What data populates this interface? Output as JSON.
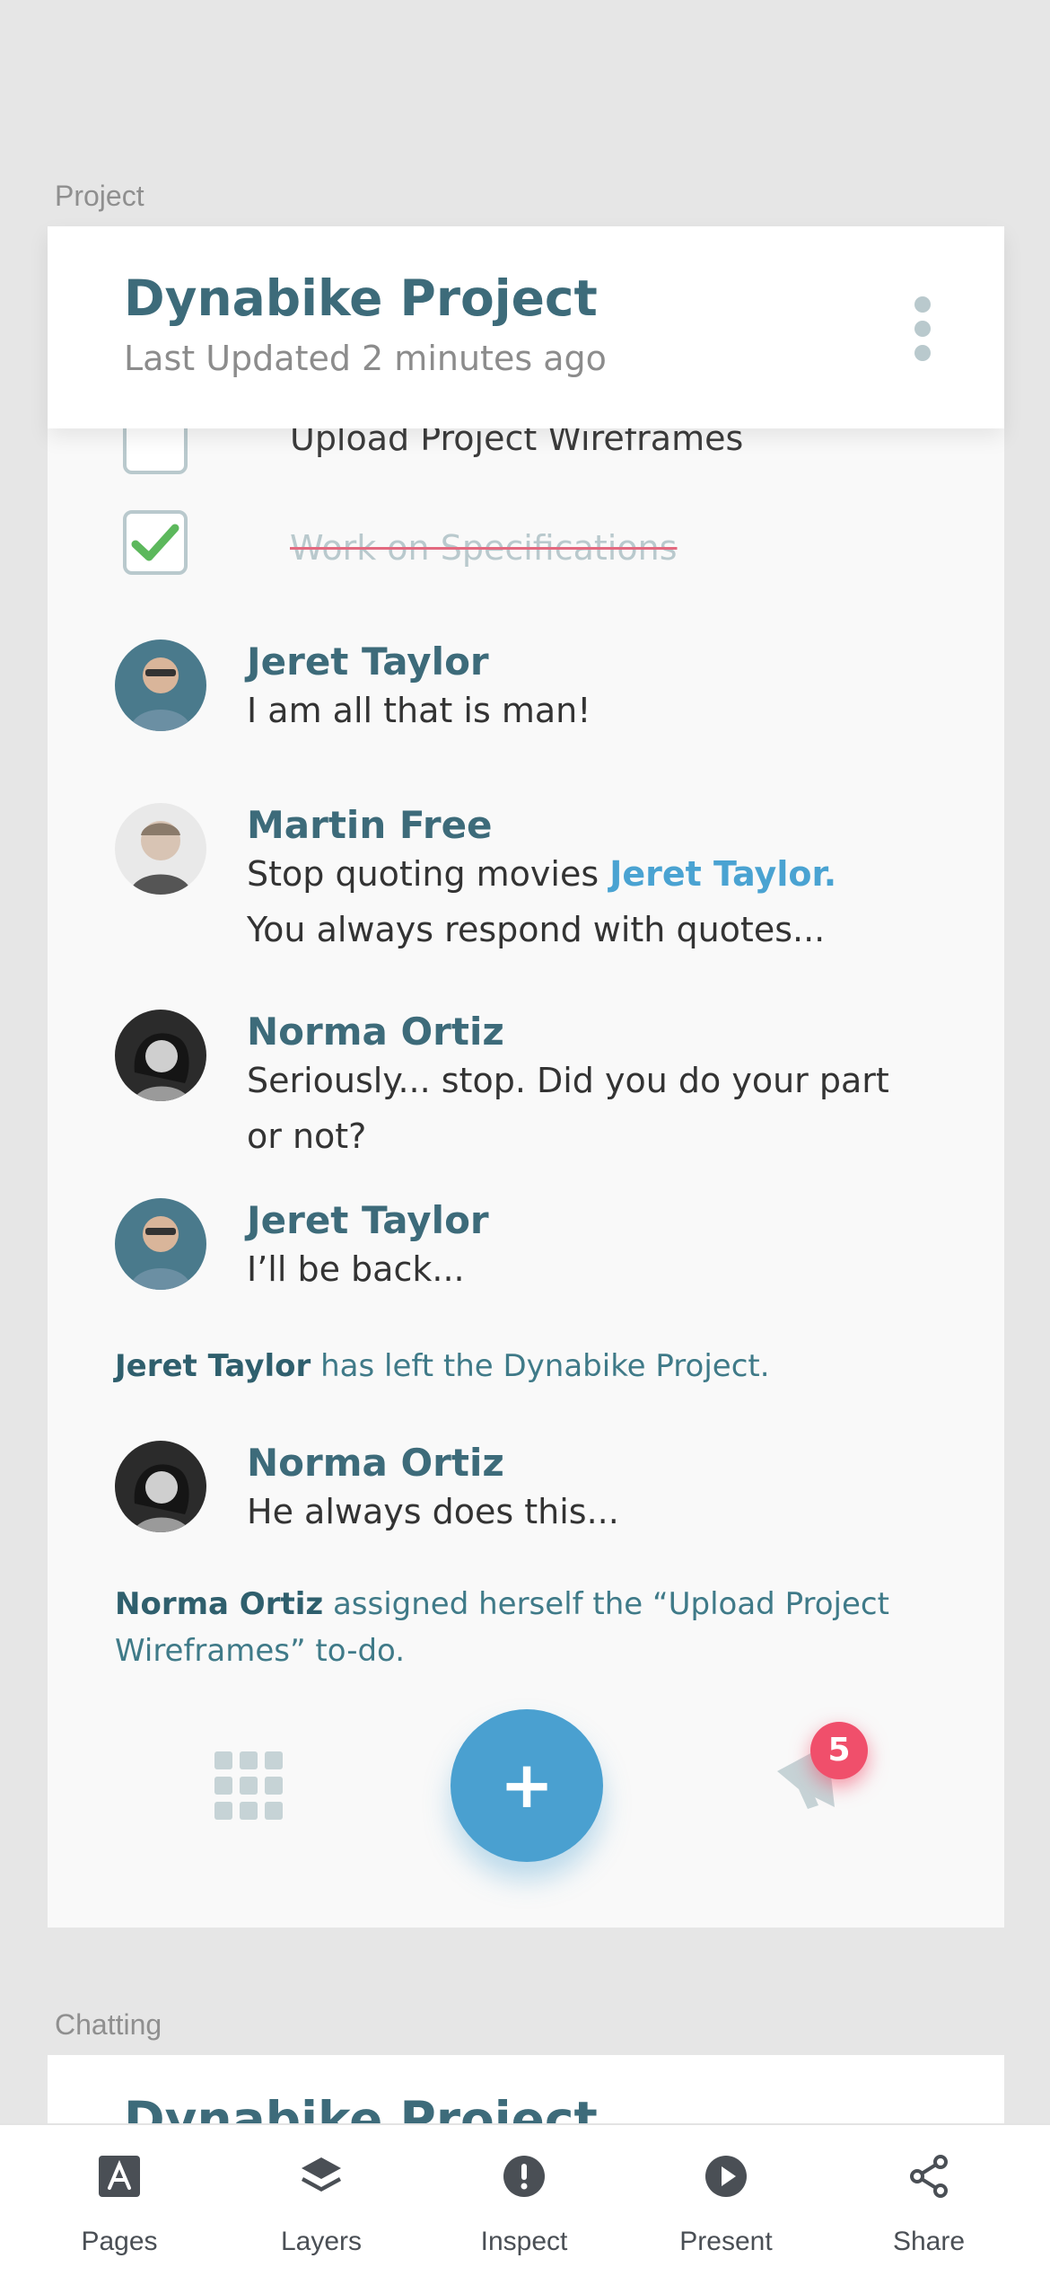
{
  "sections": {
    "project_label": "Project",
    "chatting_label": "Chatting"
  },
  "project": {
    "title": "Dynabike Project",
    "subtitle": "Last Updated 2 minutes ago"
  },
  "todos": [
    {
      "label": "Upload Project Wireframes",
      "done": false
    },
    {
      "label": "Work on Specifications",
      "done": true
    }
  ],
  "messages": [
    {
      "name": "Jeret Taylor",
      "lines": [
        "I am all that is man!"
      ]
    },
    {
      "name": "Martin Free",
      "mention": "Jeret Taylor.",
      "line1": "Stop quoting movies ",
      "line2": "You always respond with quotes..."
    },
    {
      "name": "Norma Ortiz",
      "lines": [
        "Seriously... stop. Did you do your part",
        "or not?"
      ]
    },
    {
      "name": "Jeret Taylor",
      "lines": [
        "I’ll be back..."
      ]
    },
    {
      "name": "Norma Ortiz",
      "lines": [
        "He always does this..."
      ]
    }
  ],
  "system_events": [
    {
      "actor": "Jeret Taylor",
      "text": " has left the Dynabike Project."
    },
    {
      "actor": "Norma Ortiz",
      "text": " assigned herself the “Upload Project Wireframes” to-do."
    }
  ],
  "actions": {
    "fab_symbol": "+",
    "notification_count": "5"
  },
  "chatting_card": {
    "title": "Dynabike Project"
  },
  "tabbar": {
    "items": [
      {
        "label": "Pages",
        "icon": "pages-icon"
      },
      {
        "label": "Layers",
        "icon": "layers-icon"
      },
      {
        "label": "Inspect",
        "icon": "inspect-icon"
      },
      {
        "label": "Present",
        "icon": "present-icon"
      },
      {
        "label": "Share",
        "icon": "share-icon"
      }
    ]
  },
  "colors": {
    "accent": "#4aa0d0",
    "name_text": "#3d6b7a",
    "badge": "#f04f6b",
    "check": "#5cb85c"
  }
}
